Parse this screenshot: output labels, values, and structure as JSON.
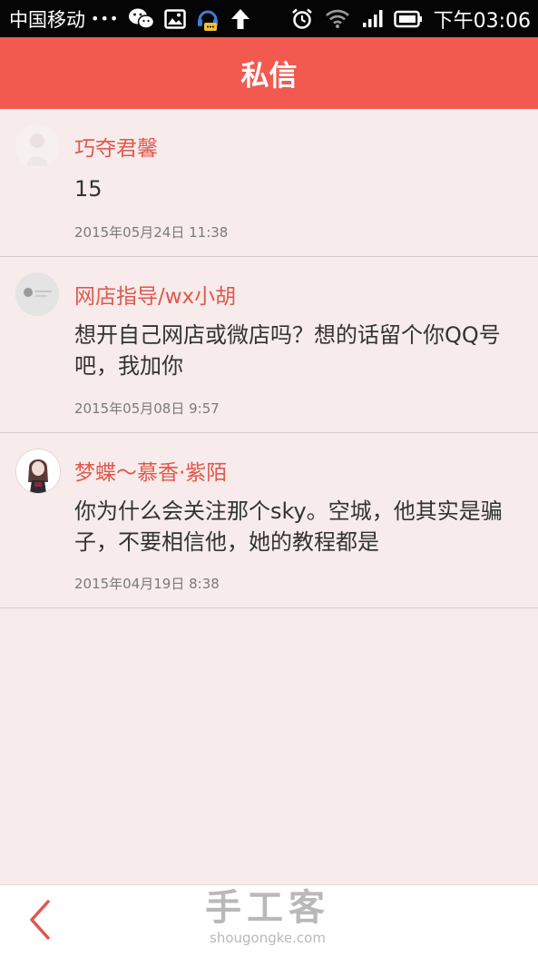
{
  "status_bar": {
    "carrier": "中国移动",
    "dots": "•••",
    "time": "下午03:06"
  },
  "header": {
    "title": "私信"
  },
  "messages": [
    {
      "sender": "巧夺君馨",
      "text": "15",
      "date": "2015年05月24日 11:38"
    },
    {
      "sender": "网店指导/wx小胡",
      "text": "想开自己网店或微店吗？想的话留个你QQ号吧，我加你",
      "date": "2015年05月08日 9:57"
    },
    {
      "sender": "梦蝶～慕香·紫陌",
      "text": "你为什么会关注那个sky。空城，他其实是骗子，不要相信他，她的教程都是",
      "date": "2015年04月19日 8:38"
    }
  ],
  "watermark": {
    "brand": "手工客",
    "domain": "shougongke.com"
  },
  "colors": {
    "accent": "#f25a4f",
    "sender": "#e0584d",
    "background": "#f7eceb"
  }
}
